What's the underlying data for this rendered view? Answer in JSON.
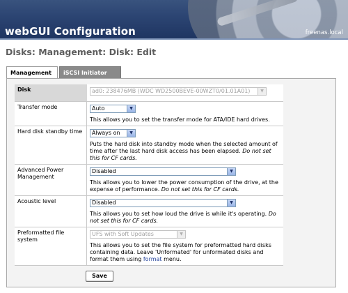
{
  "header": {
    "title": "webGUI Configuration",
    "hostname": "freenas.local"
  },
  "page_title": "Disks: Management: Disk: Edit",
  "tabs": [
    {
      "label": "Management",
      "active": true
    },
    {
      "label": "iSCSI Initiator",
      "active": false
    }
  ],
  "form": {
    "disk": {
      "label": "Disk",
      "value": "ad0: 238476MB (WDC WD2500BEVE-00WZT0/01.01A01)"
    },
    "transfer_mode": {
      "label": "Transfer mode",
      "value": "Auto",
      "desc": "This allows you to set the transfer mode for ATA/IDE hard drives."
    },
    "standby": {
      "label": "Hard disk standby time",
      "value": "Always on",
      "desc": "Puts the hard disk into standby mode when the selected amount of time after the last hard disk access has been elapsed.",
      "note": "Do not set this for CF cards."
    },
    "apm": {
      "label": "Advanced Power Management",
      "value": "Disabled",
      "desc": "This allows you to lower the power consumption of the drive, at the expense of performance.",
      "note": "Do not set this for CF cards."
    },
    "acoustic": {
      "label": "Acoustic level",
      "value": "Disabled",
      "desc": "This allows you to set how loud the drive is while it's operating.",
      "note": "Do not set this for CF cards."
    },
    "fs": {
      "label": "Preformatted file system",
      "value": "UFS with Soft Updates",
      "desc1": "This allows you to set the file system for preformatted hard disks containing data.",
      "desc2": "Leave 'Unformated' for unformated disks and format them using",
      "link": "format",
      "desc3": "menu."
    },
    "save_label": "Save"
  },
  "colors": {
    "header_bg": "#2c4573",
    "tab_inactive": "#8a8a8a",
    "link": "#1f3f9a"
  }
}
